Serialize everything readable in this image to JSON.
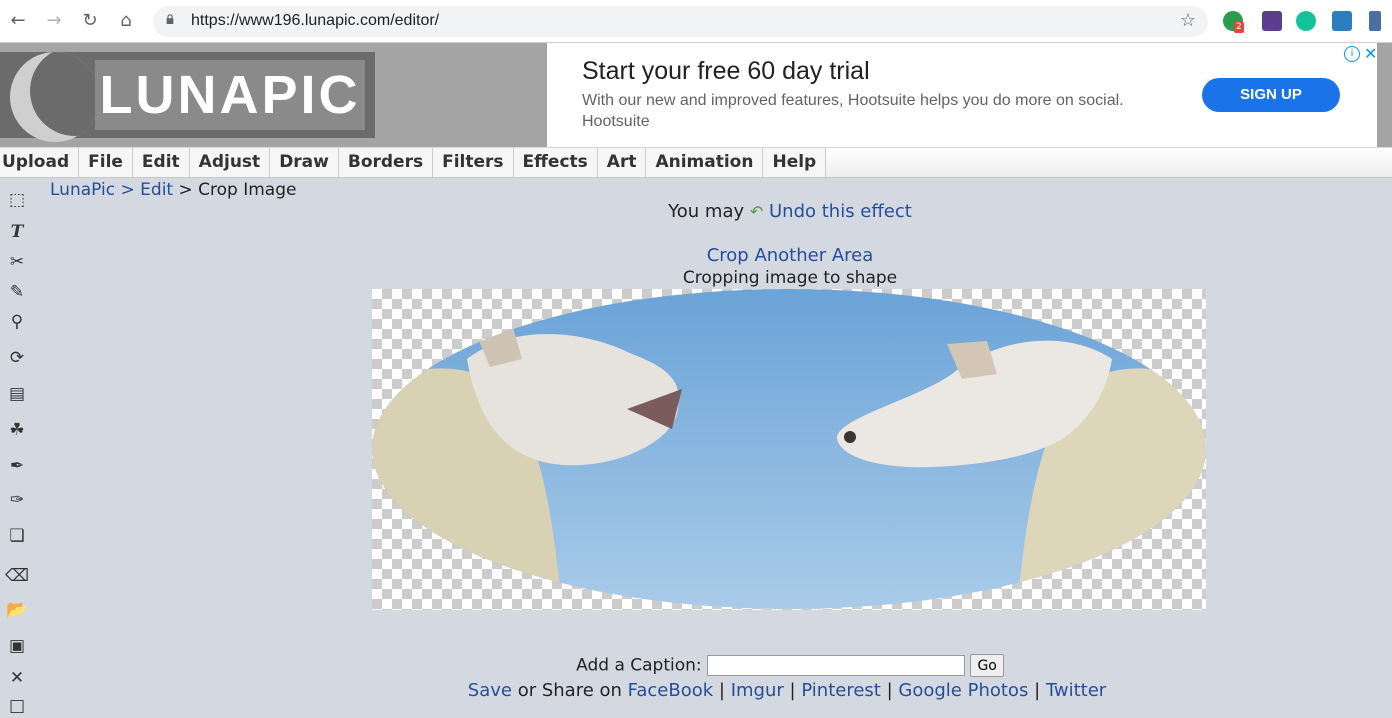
{
  "browser": {
    "url": "https://www196.lunapic.com/editor/",
    "extension_badge": "2",
    "colors": {
      "accent": "#1a73e8"
    }
  },
  "logo": {
    "text": "LUNAPIC"
  },
  "ad": {
    "title": "Start your free 60 day trial",
    "description": "With our new and improved features, Hootsuite helps you do more on social.",
    "brand": "Hootsuite",
    "cta": "SIGN UP"
  },
  "menu": {
    "items": [
      "Upload",
      "File",
      "Edit",
      "Adjust",
      "Draw",
      "Borders",
      "Filters",
      "Effects",
      "Art",
      "Animation",
      "Help"
    ]
  },
  "toolbar": {
    "tools": [
      "select-icon",
      "text-icon",
      "scissors-icon",
      "pencil-icon",
      "magnifier-icon",
      "rotate-icon",
      "gradient-icon",
      "paint-bucket-icon",
      "eyedropper-icon",
      "brush-icon",
      "layers-icon",
      "eraser-icon",
      "open-folder-icon",
      "save-icon",
      "close-icon",
      "new-file-icon"
    ]
  },
  "breadcrumb": {
    "home": "LunaPic",
    "sep1": ">",
    "section": "Edit",
    "sep2": ">",
    "current": "Crop Image"
  },
  "undo": {
    "prefix": "You may",
    "link": "Undo this effect"
  },
  "crop": {
    "another": "Crop Another Area",
    "status": "Cropping image to shape"
  },
  "caption": {
    "label": "Add a Caption:",
    "value": "",
    "go": "Go"
  },
  "share": {
    "save": "Save",
    "middle": "or Share on",
    "sep": "|",
    "links": [
      "FaceBook",
      "Imgur",
      "Pinterest",
      "Google Photos",
      "Twitter"
    ]
  }
}
